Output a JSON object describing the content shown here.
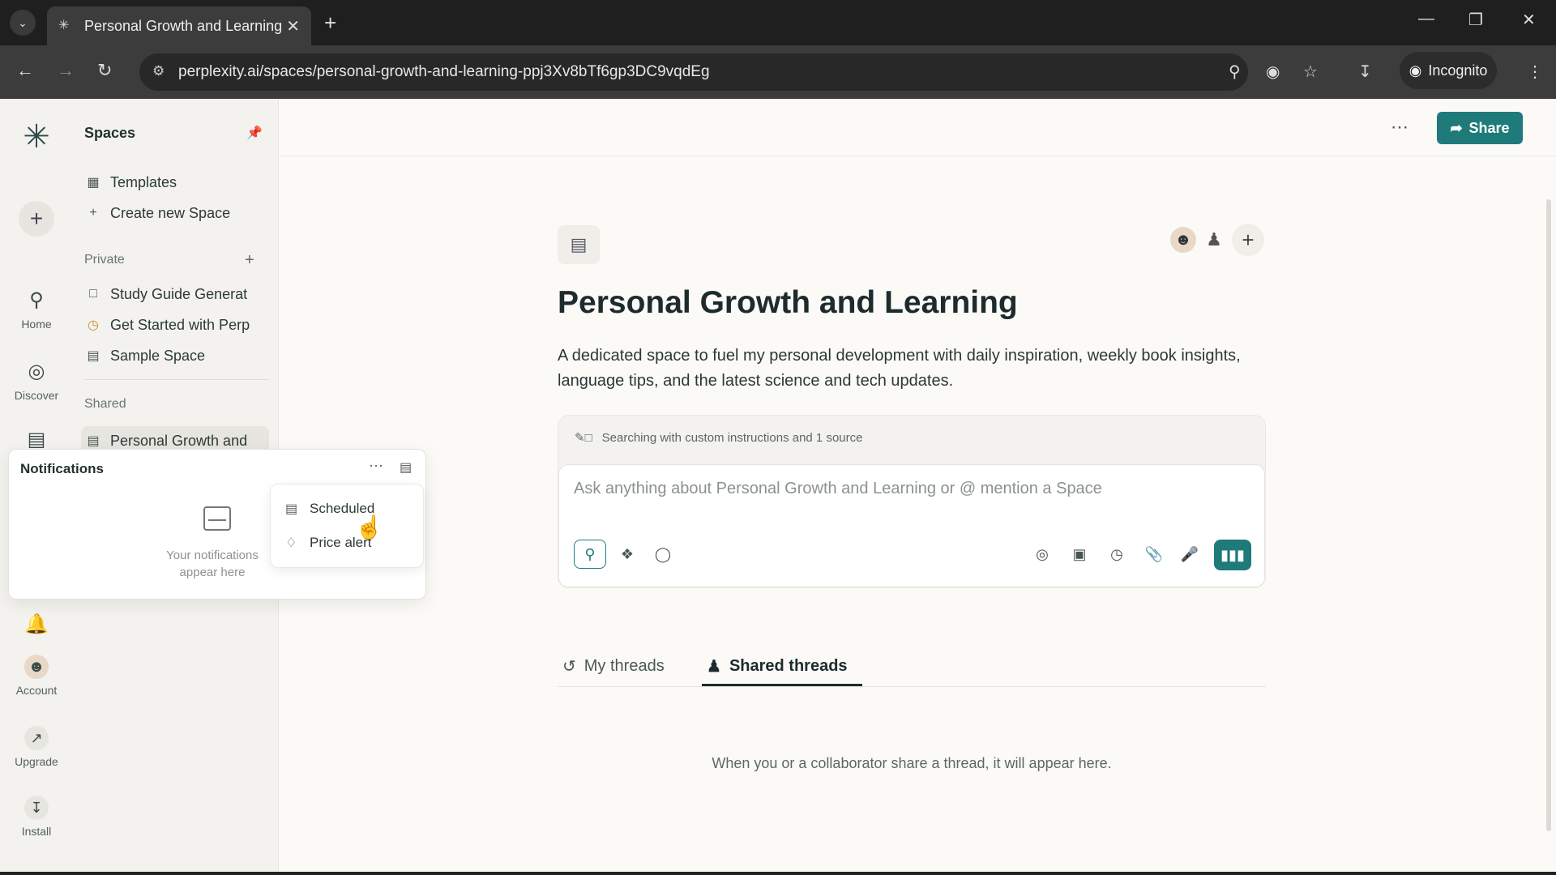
{
  "browser": {
    "tab_title": "Personal Growth and Learning",
    "url": "perplexity.ai/spaces/personal-growth-and-learning-ppj3Xv8bTf6gp3DC9vqdEg",
    "incognito_label": "Incognito"
  },
  "rail": {
    "home_label": "Home",
    "discover_label": "Discover",
    "account_label": "Account",
    "upgrade_label": "Upgrade",
    "install_label": "Install"
  },
  "sidebar": {
    "title": "Spaces",
    "templates": "Templates",
    "create_new": "Create new Space",
    "private_label": "Private",
    "private_items": [
      "Study Guide Generat",
      "Get Started with Perp",
      "Sample Space"
    ],
    "shared_label": "Shared",
    "shared_items": [
      "Personal Growth and"
    ]
  },
  "notifications": {
    "title": "Notifications",
    "empty_text": "Your notifications appear here",
    "menu": [
      "Scheduled",
      "Price alert"
    ]
  },
  "main": {
    "share_label": "Share",
    "title": "Personal Growth and Learning",
    "description": "A dedicated space to fuel my personal development with daily inspiration, weekly book insights, language tips, and the latest science and tech updates.",
    "search_meta": "Searching with custom instructions and 1 source",
    "search_placeholder": "Ask anything about Personal Growth and Learning or @ mention a Space",
    "tabs": [
      "My threads",
      "Shared threads"
    ],
    "empty_threads": "When you or a collaborator share a thread, it will appear here."
  },
  "colors": {
    "accent": "#1f7a7a",
    "background": "#fbfaf7",
    "sidebar": "#f3f2ee"
  }
}
